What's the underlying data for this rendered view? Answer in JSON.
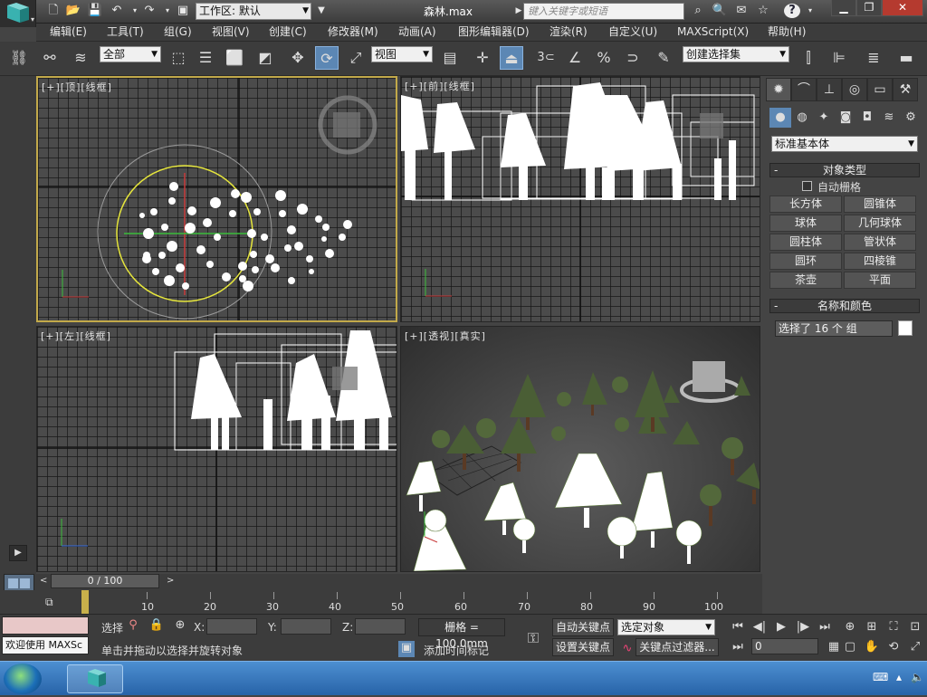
{
  "app": {
    "file_title": "森林.max",
    "workspace_label": "工作区: 默认",
    "search_placeholder": "键入关键字或短语"
  },
  "menu": [
    "编辑(E)",
    "工具(T)",
    "组(G)",
    "视图(V)",
    "创建(C)",
    "修改器(M)",
    "动画(A)",
    "图形编辑器(D)",
    "渲染(R)",
    "自定义(U)",
    "MAXScript(X)",
    "帮助(H)"
  ],
  "toolbar": {
    "selection_filter": "全部",
    "ref_coord": "视图",
    "snap_value": "3",
    "named_selection": "创建选择集"
  },
  "viewports": {
    "top": "[+][顶][线框]",
    "front": "[+][前][线框]",
    "left": "[+][左][线框]",
    "persp": "[+][透视][真实]"
  },
  "command_panel": {
    "category_dropdown": "标准基本体",
    "rollout_object_type": "对象类型",
    "autogrid_label": "自动栅格",
    "autogrid_checked": false,
    "buttons": [
      "长方体",
      "圆锥体",
      "球体",
      "几何球体",
      "圆柱体",
      "管状体",
      "圆环",
      "四棱锥",
      "茶壶",
      "平面"
    ],
    "rollout_name_color": "名称和颜色",
    "name_field": "选择了 16 个 组",
    "object_color": "#ffffff"
  },
  "timeline": {
    "slider_text": "0 / 100",
    "current_frame": 0,
    "total_frames": 100,
    "labels": [
      "10",
      "20",
      "30",
      "40",
      "50",
      "60",
      "70",
      "80",
      "90",
      "100"
    ]
  },
  "status": {
    "listener_text": "欢迎使用 MAXSc",
    "selection_text": "选择",
    "x_label": "X:",
    "y_label": "Y:",
    "z_label": "Z:",
    "grid_text": "栅格 = 100.0mm",
    "prompt": "单击并拖动以选择并旋转对象",
    "add_time_tag": "添加时间标记",
    "auto_key": "自动关键点",
    "set_key": "设置关键点",
    "key_mode_dropdown": "选定对象",
    "key_filters": "关键点过滤器...",
    "frame_field": "0"
  },
  "colors": {
    "active_viewport_border": "#c2a94a",
    "active_tool": "#5c87b4",
    "taskbar": "#2f6fb6"
  }
}
